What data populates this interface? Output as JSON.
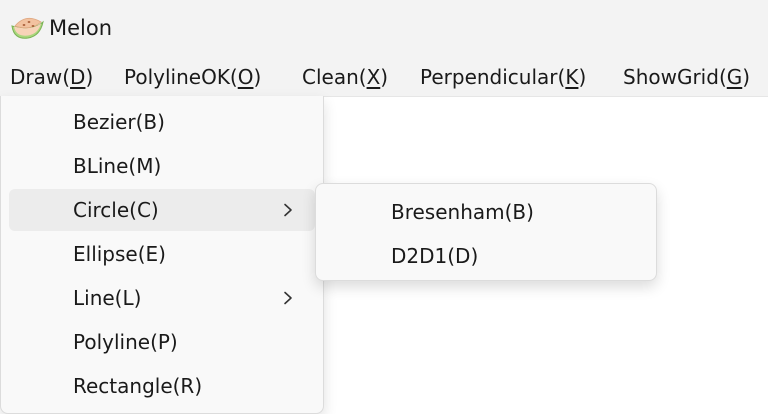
{
  "window": {
    "title": "Melon",
    "icon": "melon-slice-icon"
  },
  "menubar": {
    "items": [
      {
        "label": "Draw(",
        "key": "D",
        "close": ")"
      },
      {
        "label": "PolylineOK(",
        "key": "O",
        "close": ")"
      },
      {
        "label": "Clean(",
        "key": "X",
        "close": ")"
      },
      {
        "label": "Perpendicular(",
        "key": "K",
        "close": ")"
      },
      {
        "label": "ShowGrid(",
        "key": "G",
        "close": ")"
      }
    ]
  },
  "draw_menu": {
    "items": [
      {
        "label": "Bezier(B)",
        "submenu": false
      },
      {
        "label": "BLine(M)",
        "submenu": false
      },
      {
        "label": "Circle(C)",
        "submenu": true,
        "highlighted": true
      },
      {
        "label": "Ellipse(E)",
        "submenu": false
      },
      {
        "label": "Line(L)",
        "submenu": true
      },
      {
        "label": "Polyline(P)",
        "submenu": false
      },
      {
        "label": "Rectangle(R)",
        "submenu": false
      }
    ]
  },
  "circle_submenu": {
    "items": [
      {
        "label": "Bresenham(B)"
      },
      {
        "label": "D2D1(D)"
      }
    ]
  }
}
